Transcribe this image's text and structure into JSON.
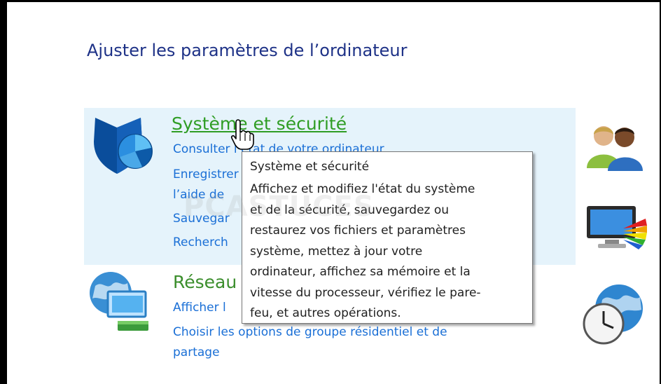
{
  "page": {
    "title": "Ajuster les paramètres de l’ordinateur"
  },
  "categories": [
    {
      "id": "system-security",
      "title": "Système et sécurité",
      "icon": "shield-icon",
      "links": [
        "Consulter l’état de votre ordinateur",
        "Enregistrer des copies de sauvegarde de vos fichiers à",
        "l’aide de",
        "Sauvegar",
        "Recherch"
      ]
    },
    {
      "id": "network",
      "title": "Réseau",
      "icon": "network-globe-icon",
      "links": [
        "Afficher l",
        "Choisir les options de groupe résidentiel et de",
        "partage"
      ]
    }
  ],
  "right_icons": [
    "users-icon",
    "display-appearance-icon",
    "clock-globe-icon"
  ],
  "tooltip": {
    "title": "Système et sécurité",
    "lines": [
      "Affichez et modifiez l'état du système",
      "et de la sécurité, sauvegardez ou",
      "restaurez vos fichiers et paramètres",
      "système, mettez à jour votre",
      "ordinateur, affichez sa mémoire et la",
      "vitesse du processeur, vérifiez le pare-",
      "feu, et autres opérations."
    ]
  },
  "cursor": "hand-pointer-icon",
  "watermark": "PCASTUCES",
  "colors": {
    "title_blue": "#1e3287",
    "link_blue": "#1a6fd6",
    "category_green": "#3b8e2c",
    "hover_background": "#e5f3fb"
  }
}
